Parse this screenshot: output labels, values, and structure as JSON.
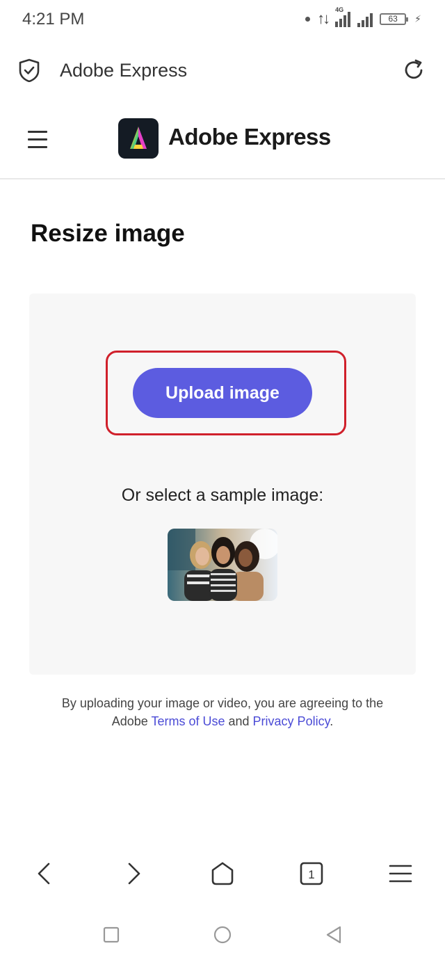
{
  "status_bar": {
    "time": "4:21 PM",
    "network_label": "4G",
    "battery_level": "63"
  },
  "browser": {
    "title": "Adobe Express"
  },
  "site_header": {
    "brand": "Adobe Express"
  },
  "main": {
    "title": "Resize image",
    "upload_button_label": "Upload image",
    "sample_label": "Or select a sample image:",
    "legal_text_1": "By uploading your image or video, you are agreeing to the",
    "legal_text_2_prefix": "Adobe ",
    "terms_link": "Terms of Use",
    "legal_and": " and ",
    "privacy_link": "Privacy Policy",
    "legal_suffix": "."
  },
  "browser_nav": {
    "tab_count": "1"
  },
  "colors": {
    "accent": "#5c5ce0",
    "highlight": "#d0202b",
    "link": "#4b4bd6"
  }
}
